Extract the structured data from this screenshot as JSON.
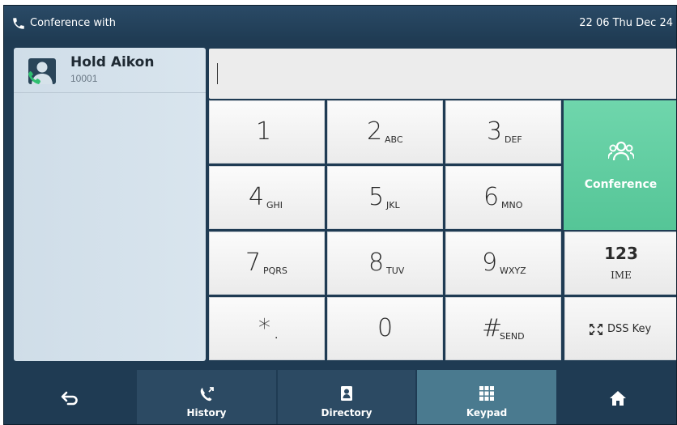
{
  "status_bar": {
    "title": "Conference with",
    "clock": "22 06 Thu Dec 24"
  },
  "contact": {
    "name": "Hold Aikon",
    "number": "10001"
  },
  "dial_input": {
    "value": ""
  },
  "keypad": {
    "keys": [
      {
        "digit": "1",
        "letters": ""
      },
      {
        "digit": "2",
        "letters": "ABC"
      },
      {
        "digit": "3",
        "letters": "DEF"
      },
      {
        "digit": "4",
        "letters": "GHI"
      },
      {
        "digit": "5",
        "letters": "JKL"
      },
      {
        "digit": "6",
        "letters": "MNO"
      },
      {
        "digit": "7",
        "letters": "PQRS"
      },
      {
        "digit": "8",
        "letters": "TUV"
      },
      {
        "digit": "9",
        "letters": "WXYZ"
      },
      {
        "digit": "*",
        "letters": "."
      },
      {
        "digit": "0",
        "letters": ""
      },
      {
        "digit": "#",
        "letters": "SEND"
      }
    ]
  },
  "side_keys": {
    "conference": "Conference",
    "ime_top": "123",
    "ime_bottom": "IME",
    "dss": "DSS Key"
  },
  "nav": {
    "history": "History",
    "directory": "Directory",
    "keypad": "Keypad"
  },
  "colors": {
    "accent_green": "#5dcc9d",
    "background": "#1f3b53",
    "active_tab": "#4a7a8f"
  }
}
